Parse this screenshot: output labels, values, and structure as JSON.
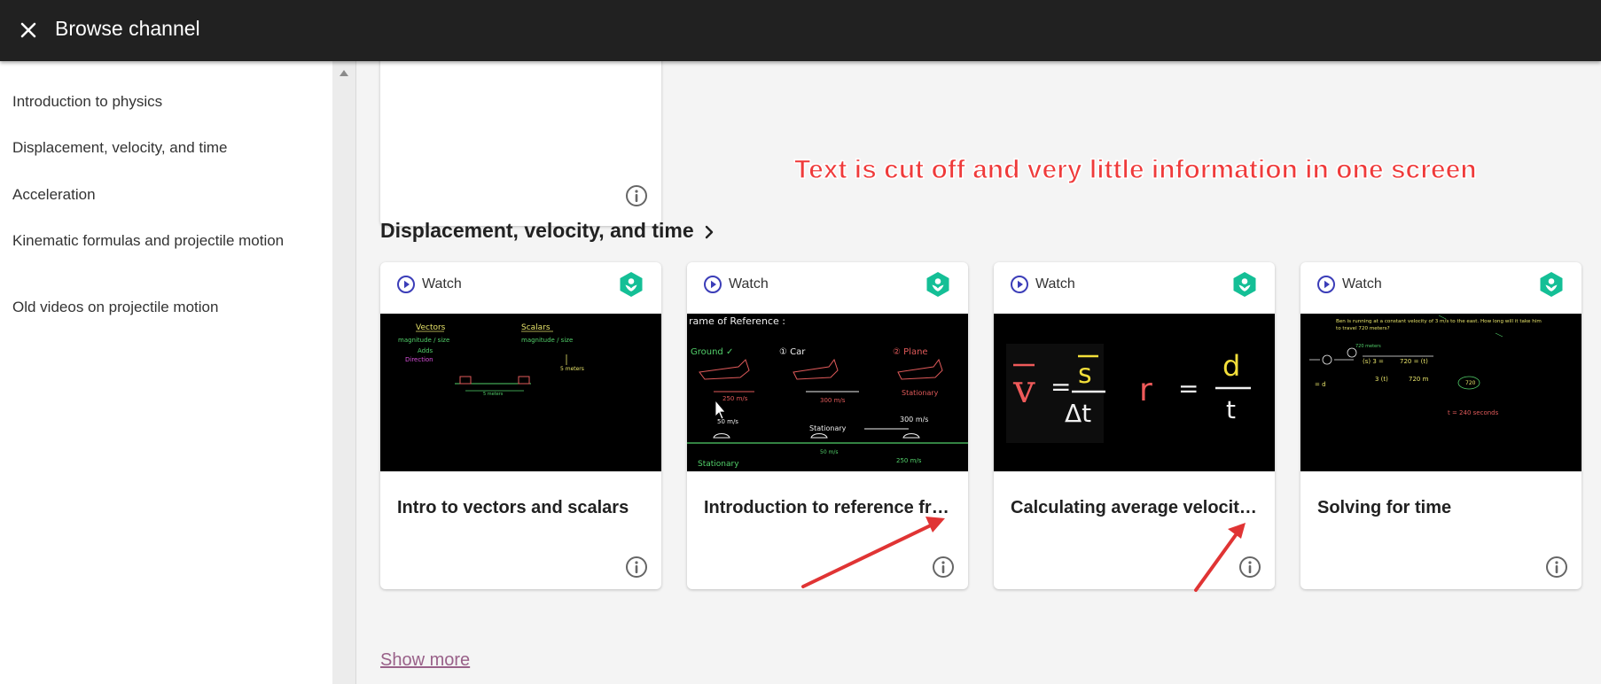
{
  "header": {
    "title": "Browse channel"
  },
  "sidebar": {
    "items": [
      {
        "label": "Introduction to physics"
      },
      {
        "label": "Displacement, velocity, and time"
      },
      {
        "label": "Acceleration"
      },
      {
        "label": "Kinematic formulas and projectile motion"
      },
      {
        "label": "Old videos on projectile motion"
      }
    ]
  },
  "section": {
    "heading": "Displacement, velocity, and time"
  },
  "cards": [
    {
      "kind_label": "Watch",
      "title": "Intro to vectors and scalars"
    },
    {
      "kind_label": "Watch",
      "title": "Introduction to reference frames"
    },
    {
      "kind_label": "Watch",
      "title": "Calculating average velocity or speed"
    },
    {
      "kind_label": "Watch",
      "title": "Solving for time"
    }
  ],
  "thumbnails": {
    "card1": [
      "Vectors",
      "Scalars",
      "magnitude / size",
      "Adds",
      "Direction",
      "5 meters",
      "5 meters",
      "5 meters"
    ],
    "card2": [
      "rame of Reference :",
      "Ground ✓",
      "① Car",
      "② Plane",
      "250 m/s",
      "300 m/s",
      "Stationary",
      "50 m/s",
      "Stationary",
      "300 m/s",
      "50 m/s",
      "250 m/s",
      "Stationary"
    ],
    "card3": [
      "v",
      "=",
      "s",
      "Δt",
      "r",
      "=",
      "d",
      "t"
    ],
    "card4": [
      "Ben is running at a constant velocity of 3 m/s to the east. How long will it take him",
      "to travel 720 meters?",
      "720 meters",
      "t = 240 seconds"
    ]
  },
  "footer": {
    "show_more": "Show more"
  },
  "annotation": {
    "text": "Text is cut off and very little information in one screen"
  },
  "icons": {
    "close": "close-icon",
    "chevron": "chevron-right-icon",
    "play": "play-circle-icon",
    "info": "info-icon",
    "brand": "khan-academy-logo"
  },
  "colors": {
    "topbar": "#212121",
    "play": "#3b3db8",
    "brand": "#14bf96",
    "link": "#996189",
    "annotation": "#ef3b3b"
  }
}
